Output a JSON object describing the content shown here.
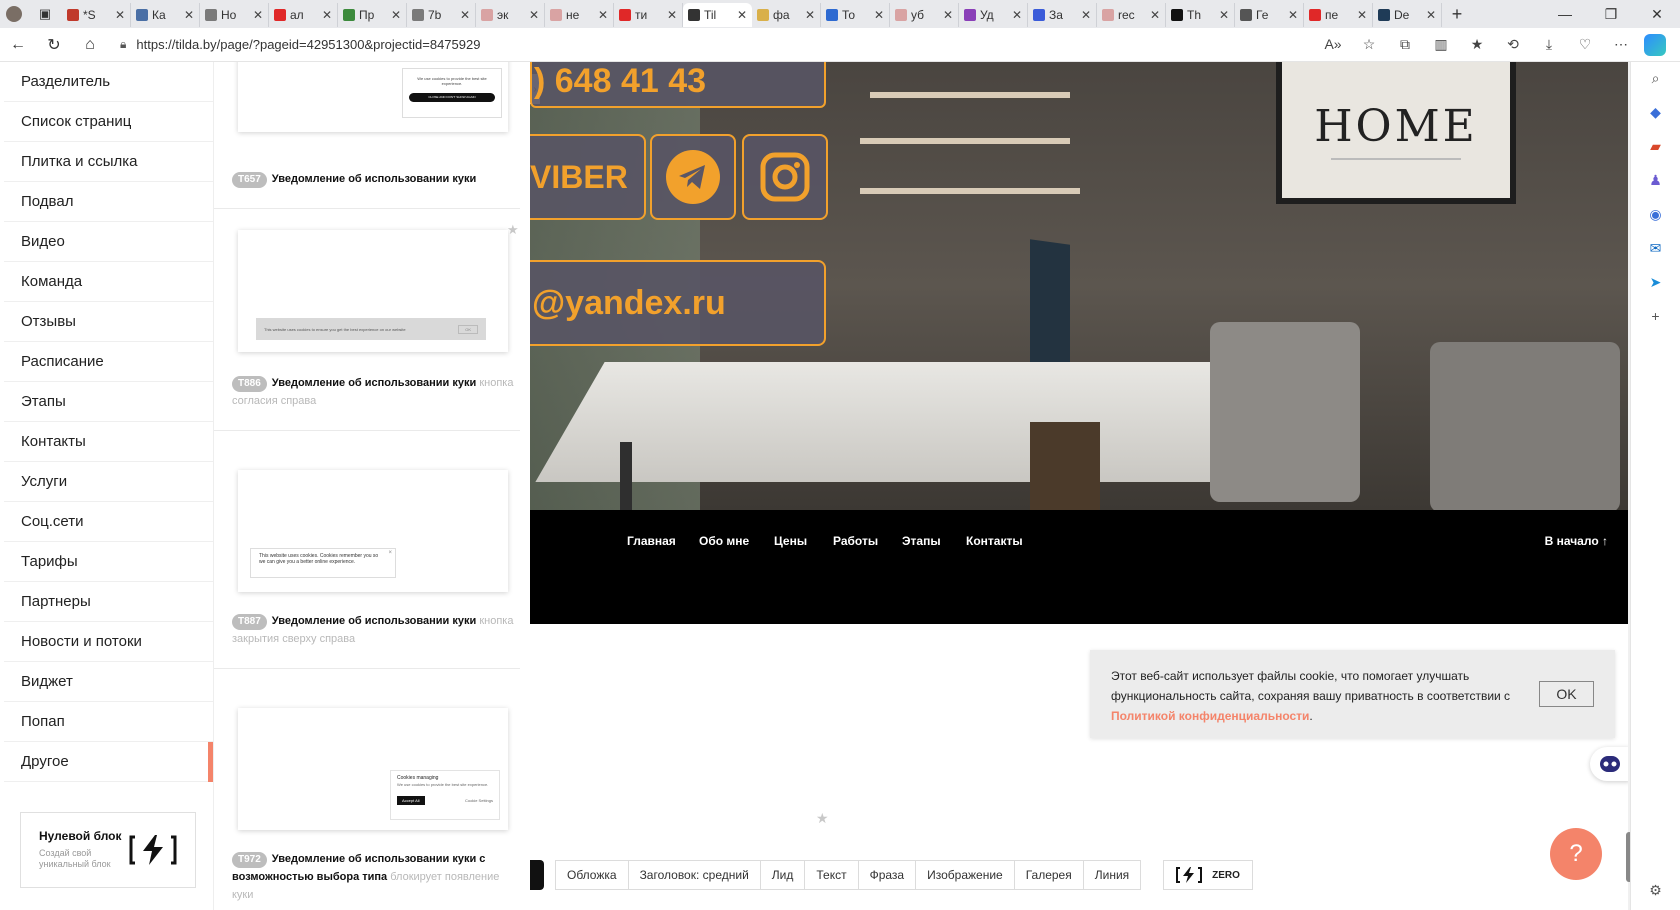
{
  "browser": {
    "tabs": [
      {
        "title": "*S",
        "favicon_color": "#c0392b"
      },
      {
        "title": "Ка",
        "favicon_color": "#4a6fa5"
      },
      {
        "title": "Но",
        "favicon_color": "#7a7a7a"
      },
      {
        "title": "ал",
        "favicon_color": "#e02828"
      },
      {
        "title": "Пр",
        "favicon_color": "#3c8a3c"
      },
      {
        "title": "7b",
        "favicon_color": "#7a7a7a"
      },
      {
        "title": "эк",
        "favicon_color": "#d9a3a3"
      },
      {
        "title": "не",
        "favicon_color": "#d9a3a3"
      },
      {
        "title": "ти",
        "favicon_color": "#e02828"
      },
      {
        "title": "Til",
        "favicon_color": "#333333",
        "active": true
      },
      {
        "title": "фа",
        "favicon_color": "#d9b04a"
      },
      {
        "title": "То",
        "favicon_color": "#2e6ad1"
      },
      {
        "title": "уб",
        "favicon_color": "#d9a3a3"
      },
      {
        "title": "Уд",
        "favicon_color": "#8a3fb8"
      },
      {
        "title": "За",
        "favicon_color": "#3a5bd9"
      },
      {
        "title": "rec",
        "favicon_color": "#d9a3a3"
      },
      {
        "title": "Th",
        "favicon_color": "#111111"
      },
      {
        "title": "Ге",
        "favicon_color": "#555555"
      },
      {
        "title": "пе",
        "favicon_color": "#e02828"
      },
      {
        "title": "De",
        "favicon_color": "#1f3b57"
      }
    ],
    "url": "https://tilda.by/page/?pageid=42951300&projectid=8475929"
  },
  "categories": {
    "items": [
      {
        "label": "Разделитель"
      },
      {
        "label": "Список страниц"
      },
      {
        "label": "Плитка и ссылка"
      },
      {
        "label": "Подвал"
      },
      {
        "label": "Видео"
      },
      {
        "label": "Команда"
      },
      {
        "label": "Отзывы"
      },
      {
        "label": "Расписание"
      },
      {
        "label": "Этапы"
      },
      {
        "label": "Контакты"
      },
      {
        "label": "Услуги"
      },
      {
        "label": "Соц.сети"
      },
      {
        "label": "Тарифы"
      },
      {
        "label": "Партнеры"
      },
      {
        "label": "Новости и потоки"
      },
      {
        "label": "Виджет"
      },
      {
        "label": "Попап"
      },
      {
        "label": "Другое",
        "active": true
      }
    ],
    "zero_block": {
      "title": "Нулевой блок",
      "subtitle": "Создай свой уникальный блок"
    }
  },
  "blocks": [
    {
      "thumb_text_1": "We use cookies to provide the best site experience.",
      "thumb_button": "CLOSE AND DON'T SHOW AGAIN",
      "code": "T657",
      "title": "Уведомление об использовании куки",
      "note": ""
    },
    {
      "thumb_text_1": "This website uses cookies to ensure you get the best experience on our website",
      "thumb_button": "OK",
      "code": "T886",
      "title": "Уведомление об использовании куки",
      "note": "кнопка согласия справа"
    },
    {
      "thumb_text_1": "This website uses cookies. Cookies remember you so we can give you a better online experience.",
      "thumb_button": "×",
      "code": "T887",
      "title": "Уведомление об использовании куки",
      "note": "кнопка закрытия сверху справа"
    },
    {
      "thumb_heading": "Cookies managing",
      "thumb_text_1": "We use cookies to provide the best site experience.",
      "thumb_button": "Accept All",
      "thumb_link": "Cookie Settings",
      "code": "T972",
      "title": "Уведомление об использовании куки с возможностью выбора типа",
      "note": "блокирует появление куки"
    }
  ],
  "hero": {
    "phone_fragment": ") 648 41 43",
    "viber_fragment": "VIBER",
    "email_fragment": "@yandex.ru",
    "poster_text": "HOME",
    "accent_color": "#f2a12c"
  },
  "footer_nav": {
    "links": [
      "Главная",
      "Обо мне",
      "Цены",
      "Работы",
      "Этапы",
      "Контакты"
    ],
    "to_top": "В начало"
  },
  "cookie_notice": {
    "text": "Этот веб-сайт использует файлы cookie, что помогает улучшать функциональность сайта, сохраняя вашу приватность в соответствии с ",
    "link": "Политикой конфиденциальности",
    "tail": ".",
    "button": "OK"
  },
  "toolbar": {
    "buttons": [
      "Обложка",
      "Заголовок: средний",
      "Лид",
      "Текст",
      "Фраза",
      "Изображение",
      "Галерея",
      "Линия"
    ],
    "zero": "ZERO"
  },
  "help_button": "?"
}
